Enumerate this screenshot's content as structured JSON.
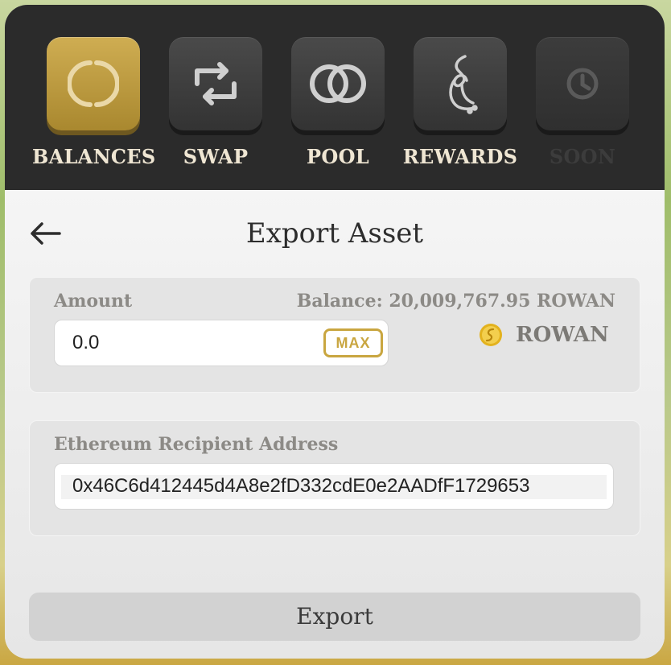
{
  "nav": {
    "items": [
      {
        "label": "BALANCES",
        "icon": "balances-ring-icon",
        "active": true
      },
      {
        "label": "SWAP",
        "icon": "swap-arrows-icon"
      },
      {
        "label": "POOL",
        "icon": "pool-rings-icon"
      },
      {
        "label": "REWARDS",
        "icon": "rewards-rope-icon"
      },
      {
        "label": "SOON",
        "icon": "clock-icon",
        "disabled": true
      }
    ]
  },
  "page": {
    "title": "Export Asset",
    "back_icon": "back-arrow-icon"
  },
  "amount": {
    "label": "Amount",
    "balance": "Balance: 20,009,767.95 ROWAN",
    "value": "0.0",
    "max_label": "MAX",
    "token": "ROWAN",
    "token_icon": "rowan-coin-icon"
  },
  "recipient": {
    "label": "Ethereum Recipient Address",
    "value": "0x46C6d412445d4A8e2fD332cdE0e2AADfF1729653"
  },
  "export_label": "Export",
  "colors": {
    "accent_gold": "#c9a640",
    "nav_bg": "#2b2b2b",
    "button_bg": "#d2d2d2"
  }
}
